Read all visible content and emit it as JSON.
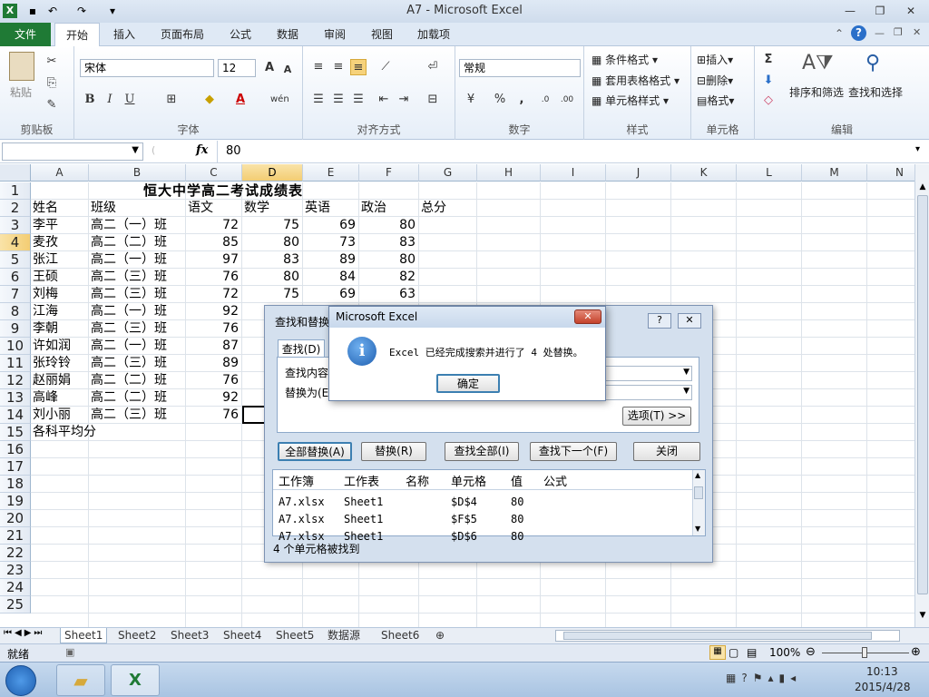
{
  "titlebar": {
    "title": "A7  -  Microsoft Excel"
  },
  "tabs": [
    "文件",
    "开始",
    "插入",
    "页面布局",
    "公式",
    "数据",
    "审阅",
    "视图",
    "加载项"
  ],
  "ribbon": {
    "clipboard": {
      "paste": "粘贴",
      "label": "剪贴板"
    },
    "font": {
      "name": "宋体",
      "size": "12",
      "label": "字体",
      "bold": "B",
      "italic": "I",
      "underline": "U"
    },
    "align": {
      "label": "对齐方式"
    },
    "number": {
      "format": "常规",
      "percent": "%",
      "comma": ",",
      "label": "数字"
    },
    "styles": {
      "cond": "条件格式",
      "table": "套用表格格式",
      "cell": "单元格样式",
      "label": "样式"
    },
    "cells": {
      "insert": "插入",
      "delete": "删除",
      "format": "格式",
      "label": "单元格"
    },
    "edit": {
      "sort": "排序和筛选",
      "find": "查找和选择",
      "label": "编辑",
      "sum": "Σ"
    }
  },
  "formula": {
    "fx": "fx",
    "value": "80"
  },
  "columns": [
    "A",
    "B",
    "C",
    "D",
    "E",
    "F",
    "G",
    "H",
    "I",
    "J",
    "K",
    "L",
    "M",
    "N"
  ],
  "rows": [
    "1",
    "2",
    "3",
    "4",
    "5",
    "6",
    "7",
    "8",
    "9",
    "10",
    "11",
    "12",
    "13",
    "14",
    "15",
    "16",
    "17",
    "18",
    "19",
    "20",
    "21",
    "22",
    "23",
    "24",
    "25"
  ],
  "sheet": {
    "title": "恒大中学高二考试成绩表",
    "headers": [
      "姓名",
      "班级",
      "语文",
      "数学",
      "英语",
      "政治",
      "总分"
    ],
    "data": [
      [
        "李平",
        "高二（一）班",
        "72",
        "75",
        "69",
        "80"
      ],
      [
        "麦孜",
        "高二（二）班",
        "85",
        "80",
        "73",
        "83"
      ],
      [
        "张江",
        "高二（一）班",
        "97",
        "83",
        "89",
        "80"
      ],
      [
        "王硕",
        "高二（三）班",
        "76",
        "80",
        "84",
        "82"
      ],
      [
        "刘梅",
        "高二（三）班",
        "72",
        "75",
        "69",
        "63"
      ],
      [
        "江海",
        "高二（一）班",
        "92",
        "",
        "",
        ""
      ],
      [
        "李朝",
        "高二（三）班",
        "76",
        "",
        "",
        ""
      ],
      [
        "许如润",
        "高二（一）班",
        "87",
        "",
        "",
        ""
      ],
      [
        "张玲铃",
        "高二（三）班",
        "89",
        "",
        "",
        ""
      ],
      [
        "赵丽娟",
        "高二（二）班",
        "76",
        "",
        "",
        ""
      ],
      [
        "高峰",
        "高二（二）班",
        "92",
        "",
        "",
        ""
      ],
      [
        "刘小丽",
        "高二（三）班",
        "76",
        "",
        "",
        ""
      ]
    ],
    "avg": "各科平均分"
  },
  "sheettabs": [
    "Sheet1",
    "Sheet2",
    "Sheet3",
    "Sheet4",
    "Sheet5",
    "数据源",
    "Sheet6"
  ],
  "status": {
    "ready": "就绪",
    "zoom": "100%"
  },
  "taskbar": {
    "time": "10:13",
    "date": "2015/4/28"
  },
  "findreplace": {
    "title": "查找和替换",
    "tab_find": "查找(D)",
    "find_label": "查找内容",
    "replace_label": "替换为(E",
    "options": "选项(T) >>",
    "replace_all": "全部替换(A)",
    "replace": "替换(R)",
    "find_all": "查找全部(I)",
    "find_next": "查找下一个(F)",
    "close": "关闭",
    "cols": [
      "工作簿",
      "工作表",
      "名称",
      "单元格",
      "值",
      "公式"
    ],
    "results": [
      [
        "A7.xlsx",
        "Sheet1",
        "",
        "$D$4",
        "80"
      ],
      [
        "A7.xlsx",
        "Sheet1",
        "",
        "$F$5",
        "80"
      ],
      [
        "A7.xlsx",
        "Sheet1",
        "",
        "$D$6",
        "80"
      ]
    ],
    "footer": "4 个单元格被找到"
  },
  "msgbox": {
    "title": "Microsoft Excel",
    "message": "Excel 已经完成搜索并进行了 4 处替换。",
    "ok": "确定"
  }
}
